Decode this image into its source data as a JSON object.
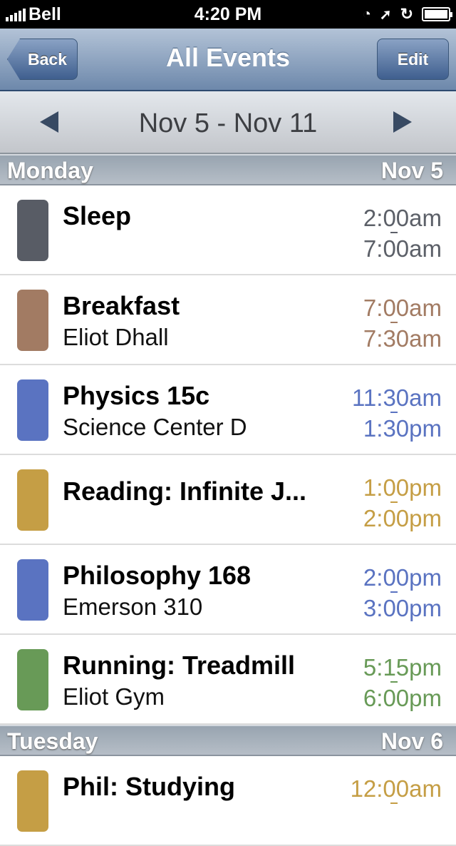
{
  "status": {
    "carrier": "Bell",
    "time": "4:20 PM"
  },
  "nav": {
    "title": "All Events",
    "back": "Back",
    "edit": "Edit"
  },
  "week": {
    "range": "Nov 5 - Nov 11"
  },
  "sections": [
    {
      "day": "Monday",
      "date": "Nov 5",
      "events": [
        {
          "name": "Sleep",
          "sub": "",
          "start": "2:00am",
          "end": "7:00am",
          "color": "#585c65",
          "time_color": "#5c6068"
        },
        {
          "name": "Breakfast",
          "sub": "Eliot Dhall",
          "start": "7:00am",
          "end": "7:30am",
          "color": "#a27b63",
          "time_color": "#a27b63"
        },
        {
          "name": "Physics 15c",
          "sub": "Science Center D",
          "start": "11:30am",
          "end": "1:30pm",
          "color": "#5a73c1",
          "time_color": "#5a73c1"
        },
        {
          "name": "Reading: Infinite J...",
          "sub": "",
          "start": "1:00pm",
          "end": "2:00pm",
          "color": "#c59e45",
          "time_color": "#c59e45"
        },
        {
          "name": "Philosophy 168",
          "sub": "Emerson 310",
          "start": "2:00pm",
          "end": "3:00pm",
          "color": "#5a73c1",
          "time_color": "#5a73c1"
        },
        {
          "name": "Running: Treadmill",
          "sub": "Eliot Gym",
          "start": "5:15pm",
          "end": "6:00pm",
          "color": "#689a57",
          "time_color": "#689a57"
        }
      ]
    },
    {
      "day": "Tuesday",
      "date": "Nov 6",
      "events": [
        {
          "name": "Phil: Studying",
          "sub": "",
          "start": "12:00am",
          "end": "",
          "color": "#c59e45",
          "time_color": "#c59e45"
        }
      ]
    }
  ]
}
